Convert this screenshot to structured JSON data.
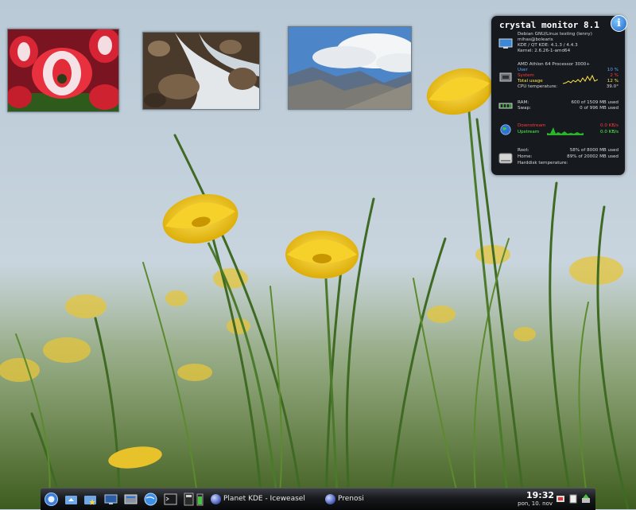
{
  "desktop": {
    "photos": [
      {
        "subject": "red-white tulips"
      },
      {
        "subject": "mountain stream over rocks"
      },
      {
        "subject": "alpine peaks and clouds"
      }
    ]
  },
  "monitor": {
    "title": "crystal monitor 8.1",
    "info_icon": "i",
    "system": [
      "Debian GNU/Linux testing (lenny)",
      "mihas@bolearis",
      "KDE / QT KDE: 4.1.3 / 4.4.3",
      "Kernel: 2.6.26-1-amd64"
    ],
    "cpu": {
      "model": "AMD Athlon 64 Processor 3000+",
      "user_label": "User",
      "user_value": "10 %",
      "system_label": "System",
      "system_value": "2 %",
      "total_label": "Total usage",
      "total_value": "12 %",
      "temp_label": "CPU temperature:",
      "temp_value": "39.0°"
    },
    "memory": {
      "ram_label": "RAM:",
      "ram_value": "600 of 1509 MB used",
      "swap_label": "Swap:",
      "swap_value": "0 of 996 MB used"
    },
    "network": {
      "down_label": "Downstream",
      "down_value": "0.0 KB/s",
      "up_label": "Upstream",
      "up_value": "0.0 KB/s"
    },
    "disk": {
      "root_label": "Root:",
      "root_value": "58% of 8000 MB used",
      "home_label": "Home:",
      "home_value": "89% of 20002 MB used",
      "temp_label": "Harddisk temperature:"
    },
    "colors": {
      "user": "#5aa8ff",
      "system": "#ff3b3b",
      "total": "#ffe34d",
      "net": "#4dff4d"
    }
  },
  "taskbar": {
    "launchers": [
      "kmenu-icon",
      "home-folder-icon",
      "favorites-folder-icon",
      "desktop-icon",
      "system-settings-icon",
      "web-browser-icon",
      "terminal-icon",
      "kate-editor-icon",
      "battery-icon"
    ],
    "tasks": [
      {
        "label": "Planet KDE - Iceweasel",
        "icon": "iceweasel-icon"
      },
      {
        "label": "Prenosi",
        "icon": "downloads-icon"
      }
    ],
    "clock": {
      "time": "19:32",
      "date": "pon, 10. nov"
    },
    "tray": [
      "network-tray-icon",
      "clipboard-tray-icon",
      "updates-tray-icon"
    ]
  }
}
